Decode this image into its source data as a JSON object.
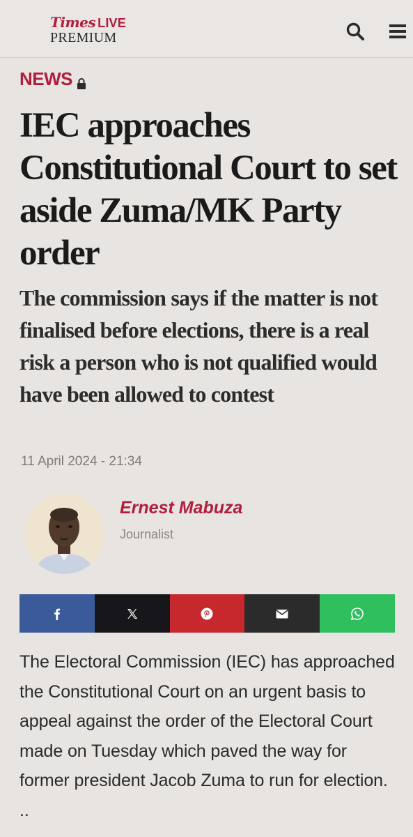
{
  "header": {
    "logo_times": "Times",
    "logo_live": "LIVE",
    "logo_premium": "PREMIUM",
    "search_icon": "search-icon",
    "menu_icon": "hamburger-menu-icon"
  },
  "article": {
    "section": "NEWS",
    "section_icon": "lock-icon",
    "headline": "IEC approaches Constitutional Court to set aside Zuma/MK Party order",
    "standfirst": "The commission says if the matter is not finalised before elections, there is a real risk a person who is not qualified would have been allowed to contest",
    "date": "11 April 2024 - 21:34",
    "author": {
      "name": "Ernest Mabuza",
      "role": "Journalist"
    },
    "share": [
      {
        "name": "facebook",
        "icon": "facebook-icon",
        "color": "#3b5a9a"
      },
      {
        "name": "x",
        "icon": "x-icon",
        "color": "#17171b"
      },
      {
        "name": "pinterest",
        "icon": "pinterest-icon",
        "color": "#c7282e"
      },
      {
        "name": "email",
        "icon": "mail-icon",
        "color": "#2b2b2b"
      },
      {
        "name": "whatsapp",
        "icon": "whatsapp-icon",
        "color": "#2fbf5e"
      }
    ],
    "body": "The Electoral Commission (IEC) has approached the Constitutional Court on an urgent basis to appeal against the order of the Electoral Court made on Tuesday which paved the way for former president Jacob Zuma to run for election. .."
  },
  "colors": {
    "accent": "#b01e3c",
    "background": "#e7e4e1"
  }
}
